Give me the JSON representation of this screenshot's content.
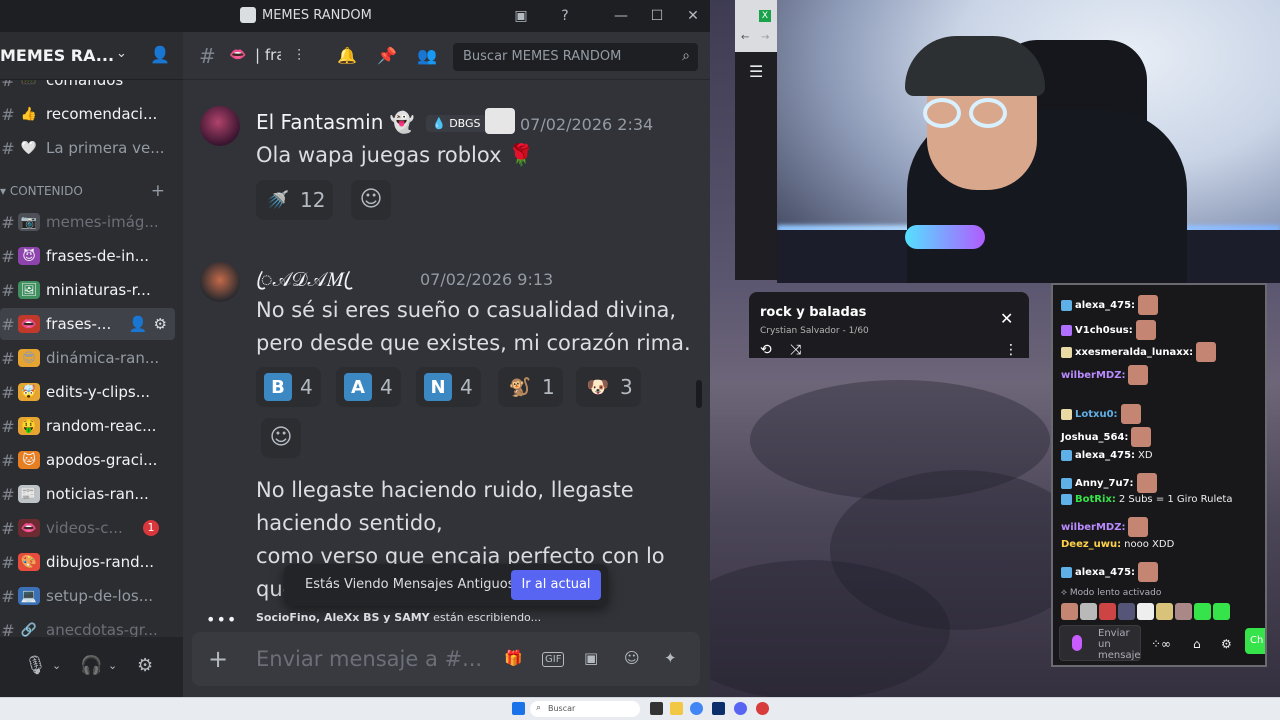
{
  "discord": {
    "window_title": "MEMES RANDOM",
    "server_name": "MEMES RA...",
    "channels": [
      {
        "emoji": "📟",
        "label": "comandos",
        "state": "bright",
        "emoji_bg": "#2b2d31"
      },
      {
        "emoji": "👍",
        "label": "recomendaci...",
        "state": "bright",
        "emoji_bg": "#2b2d31"
      },
      {
        "emoji": "🤍",
        "label": "La primera ve...",
        "state": "normal",
        "emoji_bg": "#2b2d31"
      }
    ],
    "category": "CONTENIDO",
    "content_channels": [
      {
        "emoji": "📷",
        "label": "memes-imág...",
        "state": "dim",
        "emoji_bg": "#4e5058"
      },
      {
        "emoji": "😈",
        "label": "frases-de-in...",
        "state": "bright",
        "emoji_bg": "#8e44ad"
      },
      {
        "emoji": "🖼",
        "label": "miniaturas-r...",
        "state": "bright",
        "emoji_bg": "#3f8f5f"
      },
      {
        "emoji": "👄",
        "label": "frases-...",
        "state": "active",
        "emoji_bg": "#c0392b"
      },
      {
        "emoji": "😎",
        "label": "dinámica-ran...",
        "state": "normal",
        "emoji_bg": "#e6a532"
      },
      {
        "emoji": "🤯",
        "label": "edits-y-clips...",
        "state": "bright",
        "emoji_bg": "#e6a532"
      },
      {
        "emoji": "🤑",
        "label": "random-reac...",
        "state": "bright",
        "emoji_bg": "#e6a532"
      },
      {
        "emoji": "🐱",
        "label": "apodos-graci...",
        "state": "bright",
        "emoji_bg": "#e67e22"
      },
      {
        "emoji": "📰",
        "label": "noticias-ran...",
        "state": "bright",
        "emoji_bg": "#bdc3c7"
      },
      {
        "emoji": "👄",
        "label": "videos-c...",
        "state": "dim",
        "emoji_bg": "#6b2b30",
        "badge": "1"
      },
      {
        "emoji": "🎨",
        "label": "dibujos-rand...",
        "state": "bright",
        "emoji_bg": "#e74c3c"
      },
      {
        "emoji": "💻",
        "label": "setup-de-los...",
        "state": "normal",
        "emoji_bg": "#3b6fb6"
      },
      {
        "emoji": "🔗",
        "label": "anecdotas-gr...",
        "state": "dim",
        "emoji_bg": "#2b2d31"
      }
    ],
    "header_emoji": "👄",
    "header_channel": "| fra",
    "search_placeholder": "Buscar MEMES RANDOM",
    "messages": [
      {
        "author": "El Fantasmin",
        "author_emoji": "👻",
        "tag": "💧 DBGS",
        "timestamp": "07/02/2026 2:34",
        "lines": [
          "Ola wapa juegas roblox 🌹"
        ],
        "reactions": [
          {
            "emoji": "🚿",
            "count": "12"
          }
        ]
      },
      {
        "author": "ꦿ𝒜𝒟𝒜𝑀 ꦿ",
        "timestamp": "07/02/2026 9:13",
        "lines": [
          "No sé si eres sueño o casualidad divina,",
          "pero desde que existes, mi corazón rima."
        ],
        "reactions": [
          {
            "emoji": "B",
            "count": "4",
            "color": "#3b88c3"
          },
          {
            "emoji": "A",
            "count": "4",
            "color": "#3b88c3"
          },
          {
            "emoji": "N",
            "count": "4",
            "color": "#3b88c3"
          },
          {
            "emoji": "🐒",
            "count": "1"
          },
          {
            "emoji": "🐶",
            "count": "3"
          }
        ]
      },
      {
        "lines": [
          "No llegaste haciendo ruido, llegaste",
          "haciendo sentido,",
          "como verso que encaja perfecto con lo",
          "que"
        ]
      }
    ],
    "old_messages_text": "Estás Viendo Mensajes Antiguos",
    "old_messages_button": "Ir al actual",
    "typing_names": "SocioFino, AleXx BS y SAMY",
    "typing_suffix": " están escribiendo...",
    "composer_placeholder": "Enviar mensaje a #...",
    "composer_gif": "GIF"
  },
  "song_widget": {
    "title": "rock y baladas",
    "subtitle": "Crystian Salvador - 1/60"
  },
  "stream_chat": {
    "messages": [
      {
        "user": "alexa_475:",
        "color": "#ffffff",
        "badge": "#5fb0e6",
        "text": ""
      },
      {
        "user": "V1ch0sus:",
        "color": "#ffffff",
        "badge": "#b070ff",
        "text": ""
      },
      {
        "user": "xxesmeralda_lunaxx:",
        "color": "#ffffff",
        "badge": "#e8d9a5",
        "text": ""
      },
      {
        "user": "wilberMDZ:",
        "color": "#b98bff",
        "badge": "",
        "text": ""
      },
      {
        "user": "Lotxu0:",
        "color": "#5fb0e6",
        "badge": "#e8d9a5",
        "text": ""
      },
      {
        "user": "Joshua_564:",
        "color": "#ffffff",
        "badge": "",
        "text": ""
      },
      {
        "user": "alexa_475:",
        "color": "#ffffff",
        "badge": "#5fb0e6",
        "text": "XD"
      },
      {
        "user": "Anny_7u7:",
        "color": "#ffffff",
        "badge": "#5fb0e6",
        "text": ""
      },
      {
        "user": "BotRix:",
        "color": "#36e34a",
        "badge": "#5fb0e6",
        "text": "2 Subs = 1 Giro Ruleta"
      },
      {
        "user": "wilberMDZ:",
        "color": "#b98bff",
        "badge": "",
        "text": ""
      },
      {
        "user": "Deez_uwu:",
        "color": "#ffd24a",
        "badge": "",
        "text": "nooo XDD"
      },
      {
        "user": "alexa_475:",
        "color": "#ffffff",
        "badge": "#5fb0e6",
        "text": ""
      }
    ],
    "slow_mode": "Modo lento activado",
    "input_placeholder": "Enviar un mensaje",
    "send_label": "Ch"
  },
  "taskbar": {
    "search_placeholder": "Buscar"
  }
}
